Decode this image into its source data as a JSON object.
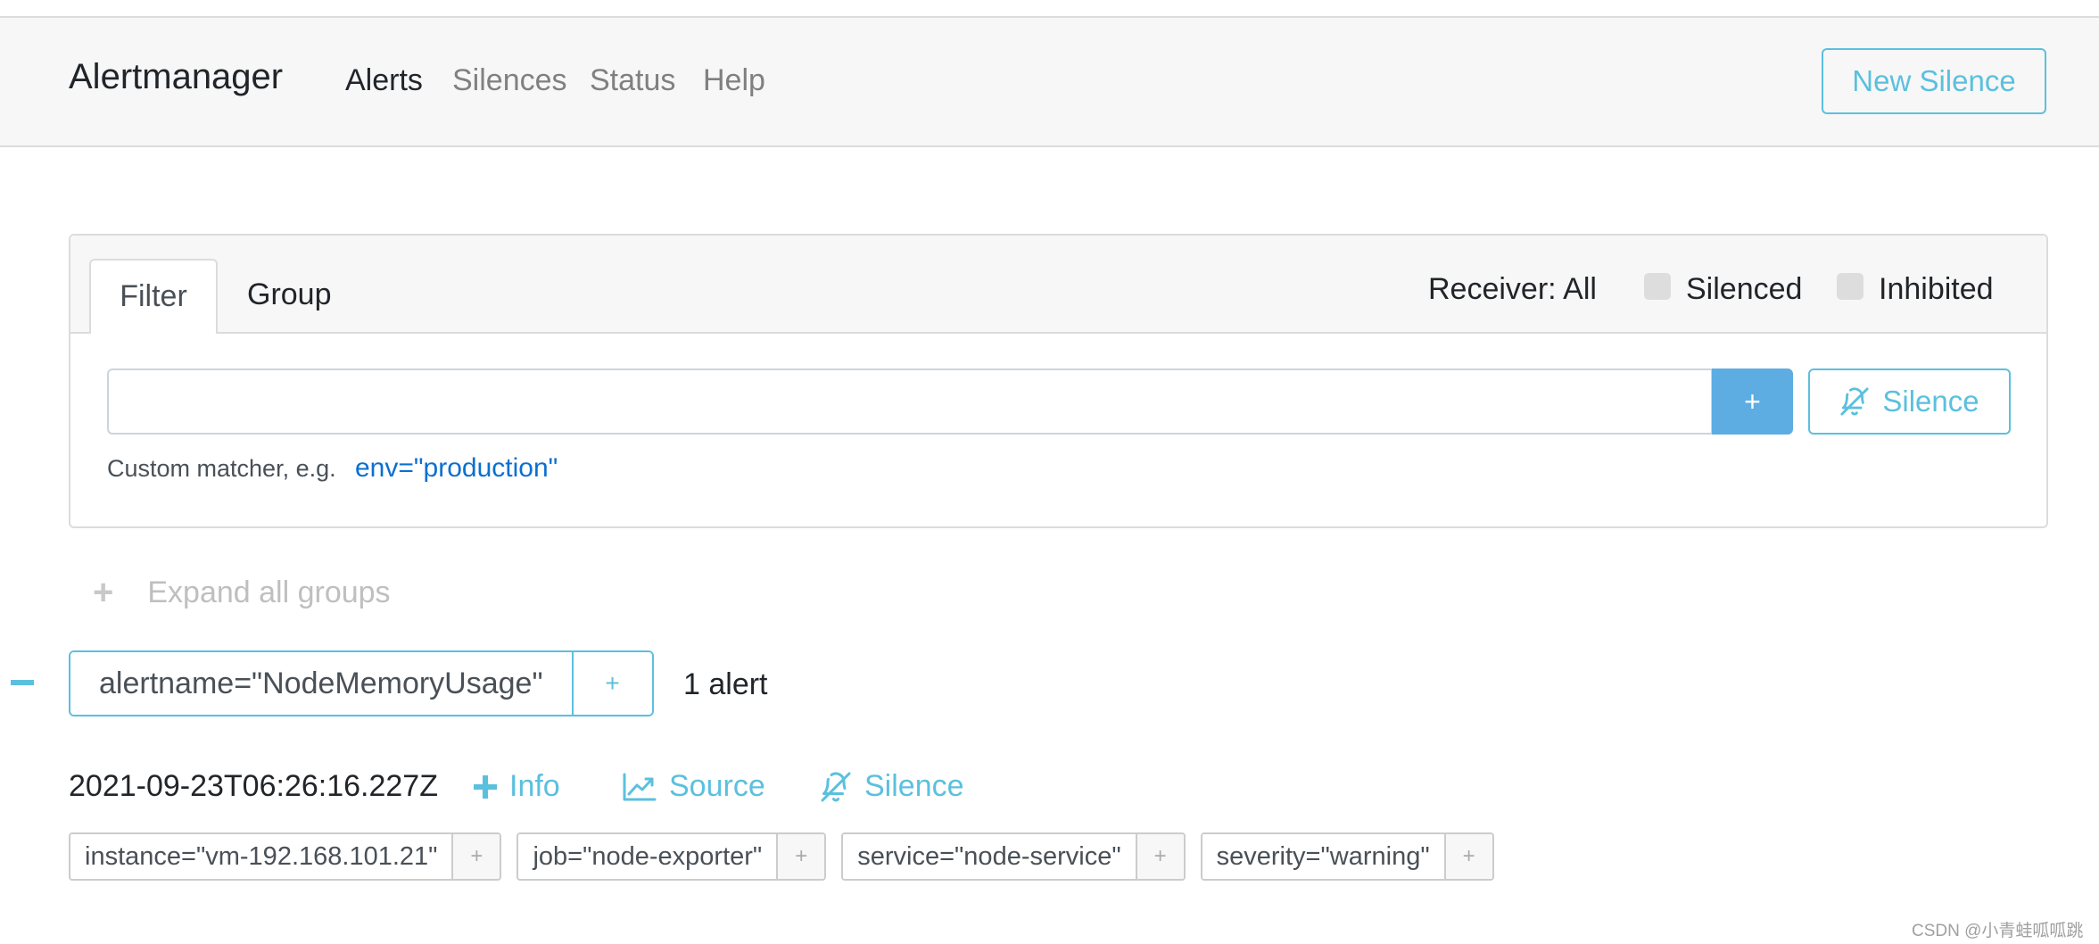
{
  "navbar": {
    "brand": "Alertmanager",
    "links": [
      "Alerts",
      "Silences",
      "Status",
      "Help"
    ],
    "new_silence_label": "New Silence"
  },
  "filter_card": {
    "tabs": [
      "Filter",
      "Group"
    ],
    "receiver_label": "Receiver: All",
    "silenced_label": "Silenced",
    "inhibited_label": "Inhibited",
    "input_value": "",
    "add_button_label": "+",
    "silence_button_label": "Silence",
    "hint_text": "Custom matcher, e.g.",
    "hint_example": "env=\"production\""
  },
  "expand_all_label": "Expand all groups",
  "group": {
    "label": "alertname=\"NodeMemoryUsage\"",
    "add_label": "+",
    "count_text": "1 alert"
  },
  "alert": {
    "timestamp": "2021-09-23T06:26:16.227Z",
    "info_label": "Info",
    "source_label": "Source",
    "silence_label": "Silence",
    "labels": [
      "instance=\"vm-192.168.101.21\"",
      "job=\"node-exporter\"",
      "service=\"node-service\"",
      "severity=\"warning\""
    ],
    "label_add": "+"
  },
  "watermark": "CSDN @小青蛙呱呱跳",
  "colors": {
    "accent": "#5bc0de",
    "link": "#0b6fd1",
    "add_button_bg": "#5dade2"
  }
}
